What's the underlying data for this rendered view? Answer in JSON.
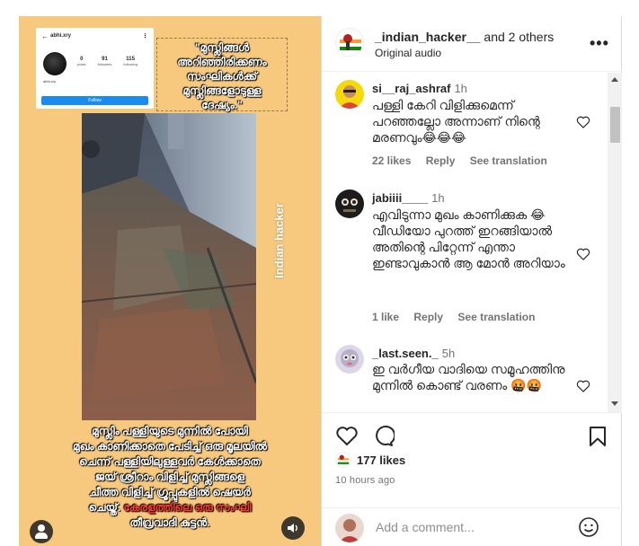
{
  "media": {
    "profile_card": {
      "back": "←",
      "username": "abhi.xry",
      "more": "⋮",
      "stats": [
        {
          "value": "0",
          "label": "posts"
        },
        {
          "value": "91",
          "label": "followers"
        },
        {
          "value": "115",
          "label": "following"
        }
      ],
      "name": "abhi.xry",
      "follow_label": "Follow"
    },
    "quote_lines": [
      "\"മുസ്ലിങ്ങൾ",
      "അറിഞ്ഞിരിക്കണം",
      "സംഘികൾക്ക്",
      "മുസ്ലിങ്ങളോടുള്ള",
      "ദേഷ്യം.\""
    ],
    "watermark": "Indian hacker",
    "caption_lines": [
      {
        "text": "മുസ്ലിം പള്ളിയുടെ മുന്നിൽ പോയി",
        "red": ""
      },
      {
        "text": "മുഖം കാണിക്കാതെ പേടിച്ച് ഒരു മൂലയിൽ",
        "red": ""
      },
      {
        "text": "ചെന്ന് പള്ളിയിലുള്ളവർ കേൾക്കാതെ",
        "red": ""
      },
      {
        "text": "ജയ് ശ്രീറാം വിളിച്ച് മുസ്ലിങ്ങളെ",
        "red": ""
      },
      {
        "text": "ചീത്ത വിളിച്ച് ഗ്രൂപ്പുകളിൽ ഷെയർ",
        "red": ""
      },
      {
        "text": "ചെയ്ത്.",
        "red": " കേരളത്തിലെ ഒരു സംഘി"
      },
      {
        "text": "തീവ്രവാദി കുട്ടൻ.",
        "red": ""
      }
    ]
  },
  "post": {
    "author": "_indian_hacker__",
    "and_others": " and 2 others",
    "audio": "Original audio",
    "more": "•••"
  },
  "comments": [
    {
      "user": "si__raj_ashraf",
      "time": "1h",
      "text": "പള്ളി കേറി വിളിക്കുമെന്ന് പറഞ്ഞല്ലോ അന്നാണ് നിന്റെ മരണവും😂😂😂",
      "likes": "22 likes",
      "reply": "Reply",
      "translate": "See translation"
    },
    {
      "user": "jabiiii____",
      "time": "1h",
      "text": "എവിടുന്നാ മുഖം കാണിക്കുക 😂 വീഡിയോ പുറത്ത് ഇറങ്ങിയാൽ അതിന്റെ പിറ്റേന്ന് എന്താ ഇണ്ടാവുകാൻ ആ മോൻ അറിയാം",
      "likes": "1 like",
      "reply": "Reply",
      "translate": "See translation"
    },
    {
      "user": "_last.seen._",
      "time": "5h",
      "text": "ഇ വർഗീയ വാദിയെ സമൂഹത്തിനു മുന്നിൽ കൊണ്ട് വരണം 🤬🤬",
      "likes": "",
      "reply": "",
      "translate": ""
    }
  ],
  "footer": {
    "likes": "177 likes",
    "time": "10 hours ago",
    "add_comment_placeholder": "Add a comment..."
  },
  "colors": {
    "media_bg": "#f7c97f",
    "follow_blue": "#1a8cf0",
    "caption_red": "#ff3b30",
    "muted": "#737373"
  }
}
